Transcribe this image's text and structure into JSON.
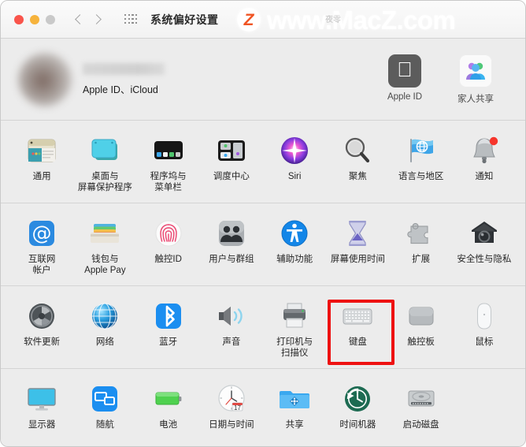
{
  "window": {
    "title": "系统偏好设置",
    "traffic_lights": [
      "close",
      "minimize",
      "zoom"
    ],
    "nav": {
      "back": "‹",
      "forward": "›"
    },
    "grid_button": "show-all-icon"
  },
  "watermark": {
    "logo": "Z",
    "text": "www.MacZ.com",
    "sub": "夜零"
  },
  "apple_id": {
    "name_redacted": "",
    "subtitle": "Apple ID、iCloud",
    "actions": [
      {
        "label": "Apple ID",
        "icon": "apple-logo-icon"
      },
      {
        "label": "家人共享",
        "icon": "family-sharing-icon"
      }
    ]
  },
  "sections": [
    {
      "name": "row-1",
      "items": [
        {
          "label": "通用",
          "icon": "general-icon"
        },
        {
          "label": "桌面与\n屏幕保护程序",
          "icon": "desktop-screensaver-icon"
        },
        {
          "label": "程序坞与\n菜单栏",
          "icon": "dock-menubar-icon"
        },
        {
          "label": "调度中心",
          "icon": "mission-control-icon"
        },
        {
          "label": "Siri",
          "icon": "siri-icon"
        },
        {
          "label": "聚焦",
          "icon": "spotlight-icon"
        },
        {
          "label": "语言与地区",
          "icon": "language-region-icon"
        },
        {
          "label": "通知",
          "icon": "notifications-icon",
          "badge": true
        }
      ]
    },
    {
      "name": "row-2",
      "items": [
        {
          "label": "互联网\n帐户",
          "icon": "internet-accounts-icon"
        },
        {
          "label": "钱包与\nApple Pay",
          "icon": "wallet-applepay-icon"
        },
        {
          "label": "触控ID",
          "icon": "touch-id-icon"
        },
        {
          "label": "用户与群组",
          "icon": "users-groups-icon"
        },
        {
          "label": "辅助功能",
          "icon": "accessibility-icon"
        },
        {
          "label": "屏幕使用时间",
          "icon": "screen-time-icon"
        },
        {
          "label": "扩展",
          "icon": "extensions-icon"
        },
        {
          "label": "安全性与隐私",
          "icon": "security-privacy-icon"
        }
      ]
    },
    {
      "name": "row-3",
      "items": [
        {
          "label": "软件更新",
          "icon": "software-update-icon"
        },
        {
          "label": "网络",
          "icon": "network-icon"
        },
        {
          "label": "蓝牙",
          "icon": "bluetooth-icon"
        },
        {
          "label": "声音",
          "icon": "sound-icon"
        },
        {
          "label": "打印机与\n扫描仪",
          "icon": "printers-scanners-icon"
        },
        {
          "label": "键盘",
          "icon": "keyboard-icon",
          "highlighted": true
        },
        {
          "label": "触控板",
          "icon": "trackpad-icon"
        },
        {
          "label": "鼠标",
          "icon": "mouse-icon"
        }
      ]
    },
    {
      "name": "row-4",
      "items": [
        {
          "label": "显示器",
          "icon": "displays-icon"
        },
        {
          "label": "随航",
          "icon": "sidecar-icon"
        },
        {
          "label": "电池",
          "icon": "battery-icon"
        },
        {
          "label": "日期与时间",
          "icon": "date-time-icon",
          "day": "17"
        },
        {
          "label": "共享",
          "icon": "sharing-icon"
        },
        {
          "label": "时间机器",
          "icon": "time-machine-icon"
        },
        {
          "label": "启动磁盘",
          "icon": "startup-disk-icon"
        }
      ]
    }
  ],
  "annotation": {
    "highlight_target": "键盘",
    "color": "#ee1111"
  }
}
